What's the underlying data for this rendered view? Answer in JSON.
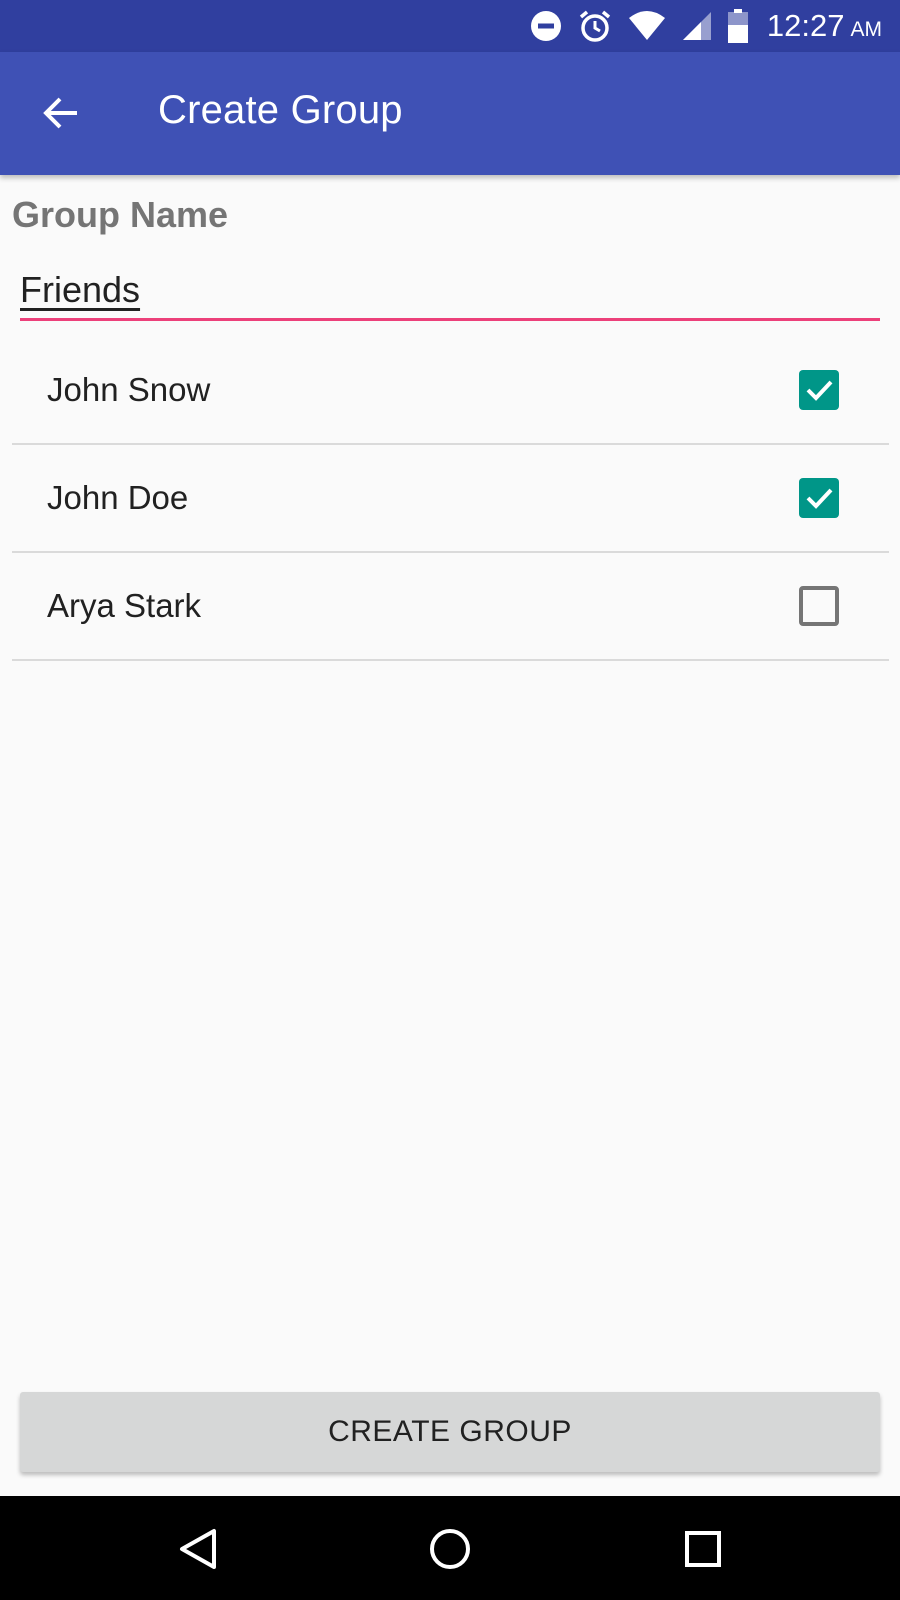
{
  "status_bar": {
    "time": "12:27",
    "ampm": "AM",
    "icons": [
      "do-not-disturb-icon",
      "alarm-icon",
      "wifi-icon",
      "cell-signal-icon",
      "battery-icon"
    ]
  },
  "app_bar": {
    "title": "Create Group",
    "back_icon": "arrow-back-icon",
    "color": "#3f51b5"
  },
  "group_name": {
    "label": "Group Name",
    "value": "Friends",
    "accent_color": "#e91e63"
  },
  "members": [
    {
      "name": "John Snow",
      "checked": true
    },
    {
      "name": "John Doe",
      "checked": true
    },
    {
      "name": "Arya Stark",
      "checked": false
    }
  ],
  "checkbox_color": "#009688",
  "create_button": {
    "label": "CREATE GROUP"
  },
  "nav_bar": {
    "icons": [
      "nav-back-icon",
      "nav-home-icon",
      "nav-recents-icon"
    ]
  }
}
